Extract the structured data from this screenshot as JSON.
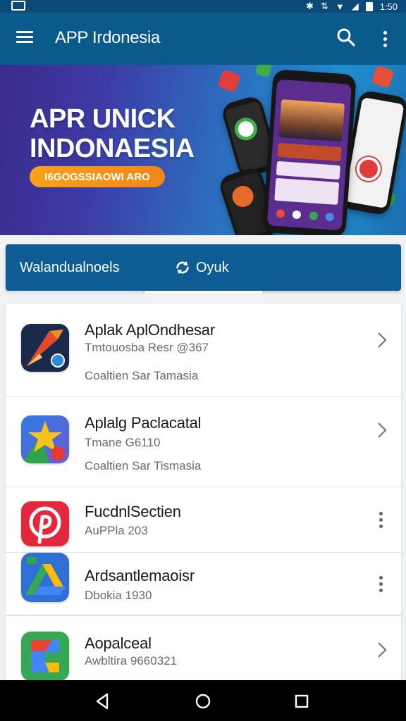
{
  "status_bar": {
    "time": "1:50",
    "icons": [
      "gallery-icon",
      "bluetooth-icon",
      "data-icon",
      "wifi-icon",
      "signal-icon",
      "battery-icon"
    ]
  },
  "app_bar": {
    "title": "APP Irdonesia",
    "icons": [
      "menu-icon",
      "search-icon",
      "more-vert-icon"
    ]
  },
  "banner": {
    "title_line1": "APR UNICK",
    "title_line2": "INDONAESIA",
    "cta_label": "I6GOGSSIAOWI ARO"
  },
  "tabs": [
    {
      "label": "Walandualnoels",
      "selected": false
    },
    {
      "label": "Oyuk",
      "selected": true,
      "icon": "sync-icon"
    }
  ],
  "apps": [
    {
      "title": "Aplak AplOndhesar",
      "subtitle": "Tmtouosba Resr @367",
      "extra": "Coaltien Sar Tamasia",
      "action": "chevron-right-icon"
    },
    {
      "title": "Aplalg Paclacatal",
      "subtitle": "Tmane G6110",
      "extra": "Coaltien Sar Tismasia",
      "action": "chevron-right-icon"
    },
    {
      "title": "FucdnlSectien",
      "subtitle": "AuPPla 203",
      "action": "more-vert-icon"
    },
    {
      "title": "Ardsantlemaoisr",
      "subtitle": "Dbokia 1930",
      "action": "more-vert-icon"
    },
    {
      "title": "Aopalceal",
      "subtitle": "Awbltira 9660321",
      "action": "chevron-right-icon"
    }
  ],
  "colors": {
    "app_bar": "#0b5a8c",
    "tabs": "#0d5d94",
    "cta": "#f39a1b"
  },
  "nav": [
    "back-icon",
    "home-icon",
    "recents-icon"
  ]
}
